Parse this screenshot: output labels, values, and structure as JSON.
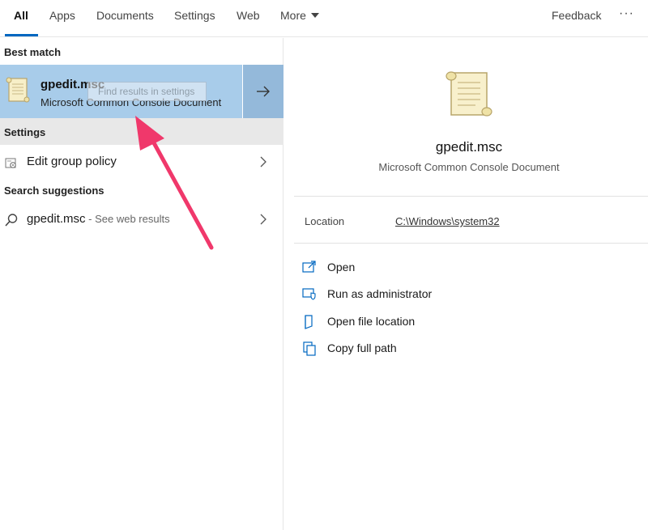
{
  "tabs": [
    {
      "label": "All",
      "active": true
    },
    {
      "label": "Apps"
    },
    {
      "label": "Documents"
    },
    {
      "label": "Settings"
    },
    {
      "label": "Web"
    },
    {
      "label": "More"
    }
  ],
  "header": {
    "feedback": "Feedback",
    "more_options": "···"
  },
  "left": {
    "best_match_header": "Best match",
    "best_match": {
      "title": "gpedit.msc",
      "subtitle": "Microsoft Common Console Document",
      "tooltip": "Find results in settings",
      "icon": "scroll-document-icon"
    },
    "settings_header": "Settings",
    "settings_item": {
      "label": "Edit group policy",
      "icon": "settings-gear-icon"
    },
    "suggestions_header": "Search suggestions",
    "suggestion": {
      "label": "gpedit.msc",
      "suffix": " - See web results",
      "icon": "search-icon"
    }
  },
  "right": {
    "title": "gpedit.msc",
    "subtitle": "Microsoft Common Console Document",
    "location_label": "Location",
    "location_value": "C:\\Windows\\system32",
    "actions": [
      {
        "label": "Open",
        "icon": "open-icon"
      },
      {
        "label": "Run as administrator",
        "icon": "shield-admin-icon"
      },
      {
        "label": "Open file location",
        "icon": "folder-location-icon"
      },
      {
        "label": "Copy full path",
        "icon": "copy-icon"
      }
    ]
  },
  "colors": {
    "selected_bg": "#a8ccea",
    "arrow_bg": "#94b9da",
    "accent": "#0067c0",
    "annotation": "#f0386b"
  }
}
